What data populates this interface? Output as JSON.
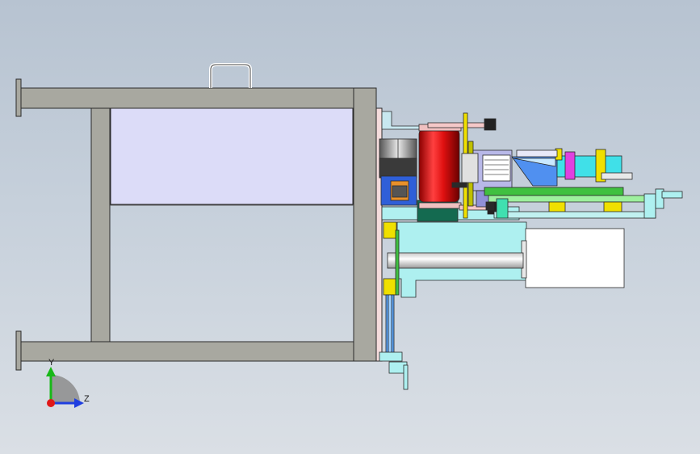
{
  "triad": {
    "y_label": "Y",
    "z_label": "Z",
    "y_color": "#18b818",
    "z_color": "#1f3fe0",
    "origin_color": "#e01818"
  },
  "colors": {
    "frame": "#a8a8a0",
    "panel": "#dcdcf8",
    "cylinder": "#e01010",
    "cyan_part": "#8ee8ee",
    "yellow_part": "#f0e000",
    "green_part": "#40c040",
    "motor": "#ffffff"
  }
}
